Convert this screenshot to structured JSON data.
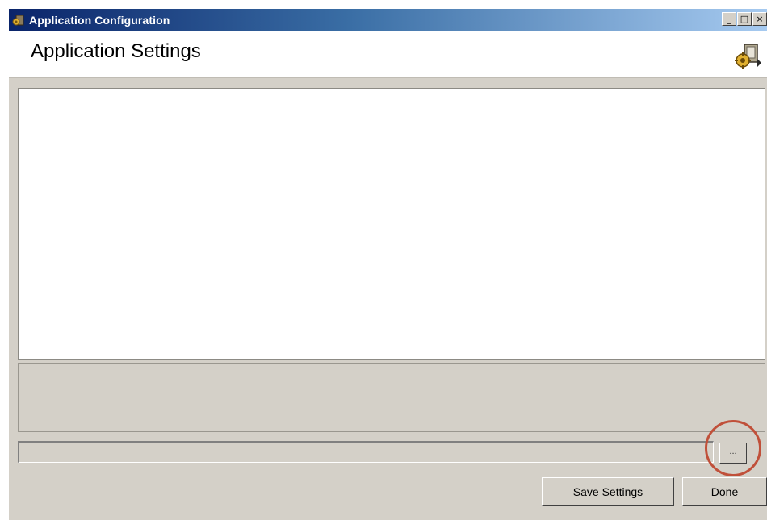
{
  "window": {
    "title": "Application Configuration",
    "icon": "app-config-icon",
    "caption_buttons": {
      "minimize": "_",
      "maximize": "□",
      "close": "×"
    }
  },
  "header": {
    "title": "Application Settings",
    "icon": "settings-wizard-icon"
  },
  "settings_panel": {
    "content": ""
  },
  "info_panel": {
    "content": ""
  },
  "path_field": {
    "value": ""
  },
  "browse_button": {
    "label": "..."
  },
  "footer": {
    "save_label": "Save Settings",
    "done_label": "Done"
  },
  "colors": {
    "titlebar_start": "#0a246a",
    "titlebar_end": "#a6caf0",
    "window_bg": "#d4d0c8",
    "highlight_ring": "#c0503a"
  }
}
